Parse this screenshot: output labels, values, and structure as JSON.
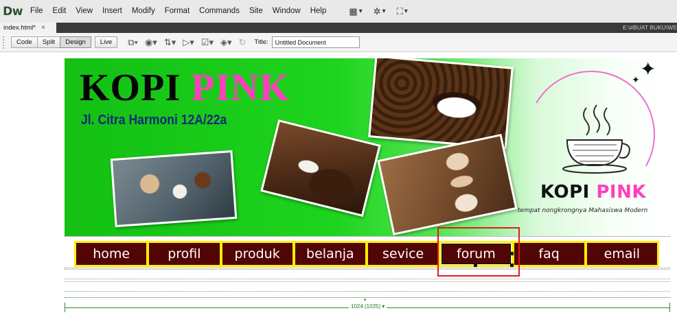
{
  "app": {
    "logo": "Dw",
    "menu": [
      "File",
      "Edit",
      "View",
      "Insert",
      "Modify",
      "Format",
      "Commands",
      "Site",
      "Window",
      "Help"
    ],
    "toolbar_icons": [
      "layout-icon",
      "settings-icon",
      "site-icon"
    ]
  },
  "document": {
    "tab_label": "index.html*",
    "close": "×",
    "path": "E:\\#BUAT BUKU\\WE"
  },
  "doc_toolbar": {
    "views": [
      "Code",
      "Split",
      "Design",
      "Live"
    ],
    "active_view": "Design",
    "title_label": "Title:",
    "title_value": "Untitled Document"
  },
  "banner": {
    "title_part1": "KOPI",
    "title_part2": "PINK",
    "address": "Jl. Citra Harmoni 12A/22a",
    "logo_part1": "KOPI",
    "logo_part2": "PINK",
    "tagline": "tempat nongkrongnya Mahasiswa Modern",
    "colors": {
      "green": "#1ed41e",
      "pink": "#ff3fbf",
      "navy": "#142a7a"
    }
  },
  "nav": {
    "items": [
      "home",
      "profil",
      "produk",
      "belanja",
      "sevice",
      "forum",
      "faq",
      "email"
    ],
    "selected": "forum",
    "colors": {
      "bar": "#ffee00",
      "item": "#520505",
      "highlight": "#e11a1a"
    }
  },
  "ruler": {
    "label": "1024 (1025) ▾"
  }
}
